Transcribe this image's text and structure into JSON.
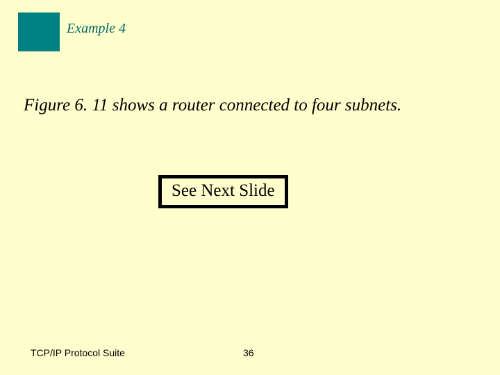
{
  "header": {
    "example_label": "Example 4"
  },
  "body": {
    "figure_text": "Figure 6. 11 shows a router connected to four subnets.",
    "see_next": "See Next Slide"
  },
  "footer": {
    "title": "TCP/IP Protocol Suite",
    "page_number": "36"
  }
}
